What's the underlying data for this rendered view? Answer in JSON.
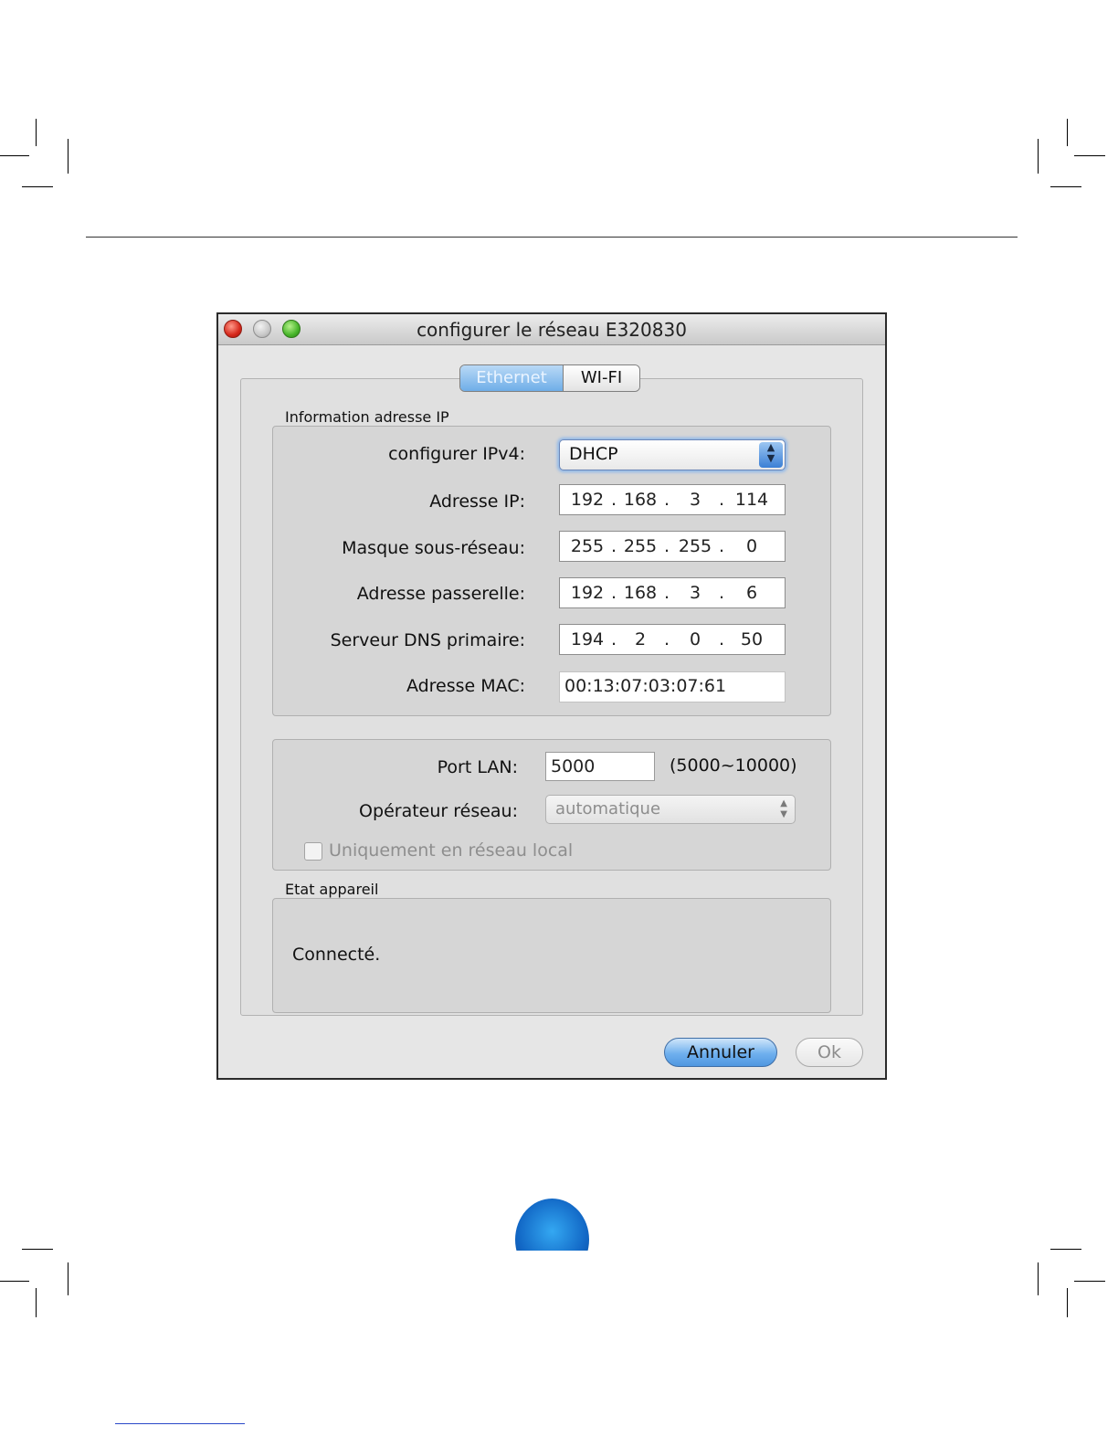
{
  "window": {
    "title": "configurer le réseau E320830"
  },
  "tabs": [
    {
      "label": "Ethernet",
      "active": true
    },
    {
      "label": "WI-FI",
      "active": false
    }
  ],
  "ip_info": {
    "group_label": "Information adresse IP",
    "configure_label": "configurer IPv4:",
    "configure_value": "DHCP",
    "ip_label": "Adresse IP:",
    "ip": [
      "192",
      "168",
      "3",
      "114"
    ],
    "subnet_label": "Masque sous-réseau:",
    "subnet": [
      "255",
      "255",
      "255",
      "0"
    ],
    "gateway_label": "Adresse passerelle:",
    "gateway": [
      "192",
      "168",
      "3",
      "6"
    ],
    "dns_label": "Serveur DNS primaire:",
    "dns": [
      "194",
      "2",
      "0",
      "50"
    ],
    "mac_label": "Adresse MAC:",
    "mac": "00:13:07:03:07:61"
  },
  "lan": {
    "port_label": "Port LAN:",
    "port_value": "5000",
    "port_range": "(5000~10000)",
    "operator_label": "Opérateur réseau:",
    "operator_value": "automatique",
    "local_only_label": "Uniquement en réseau local",
    "local_only_checked": false
  },
  "status": {
    "group_label": "Etat appareil",
    "text": "Connecté."
  },
  "buttons": {
    "cancel": "Annuler",
    "ok": "Ok"
  },
  "colors": {
    "accent_blue": "#6fb0ee",
    "close": "#d5281b",
    "maximize": "#47b52a"
  }
}
